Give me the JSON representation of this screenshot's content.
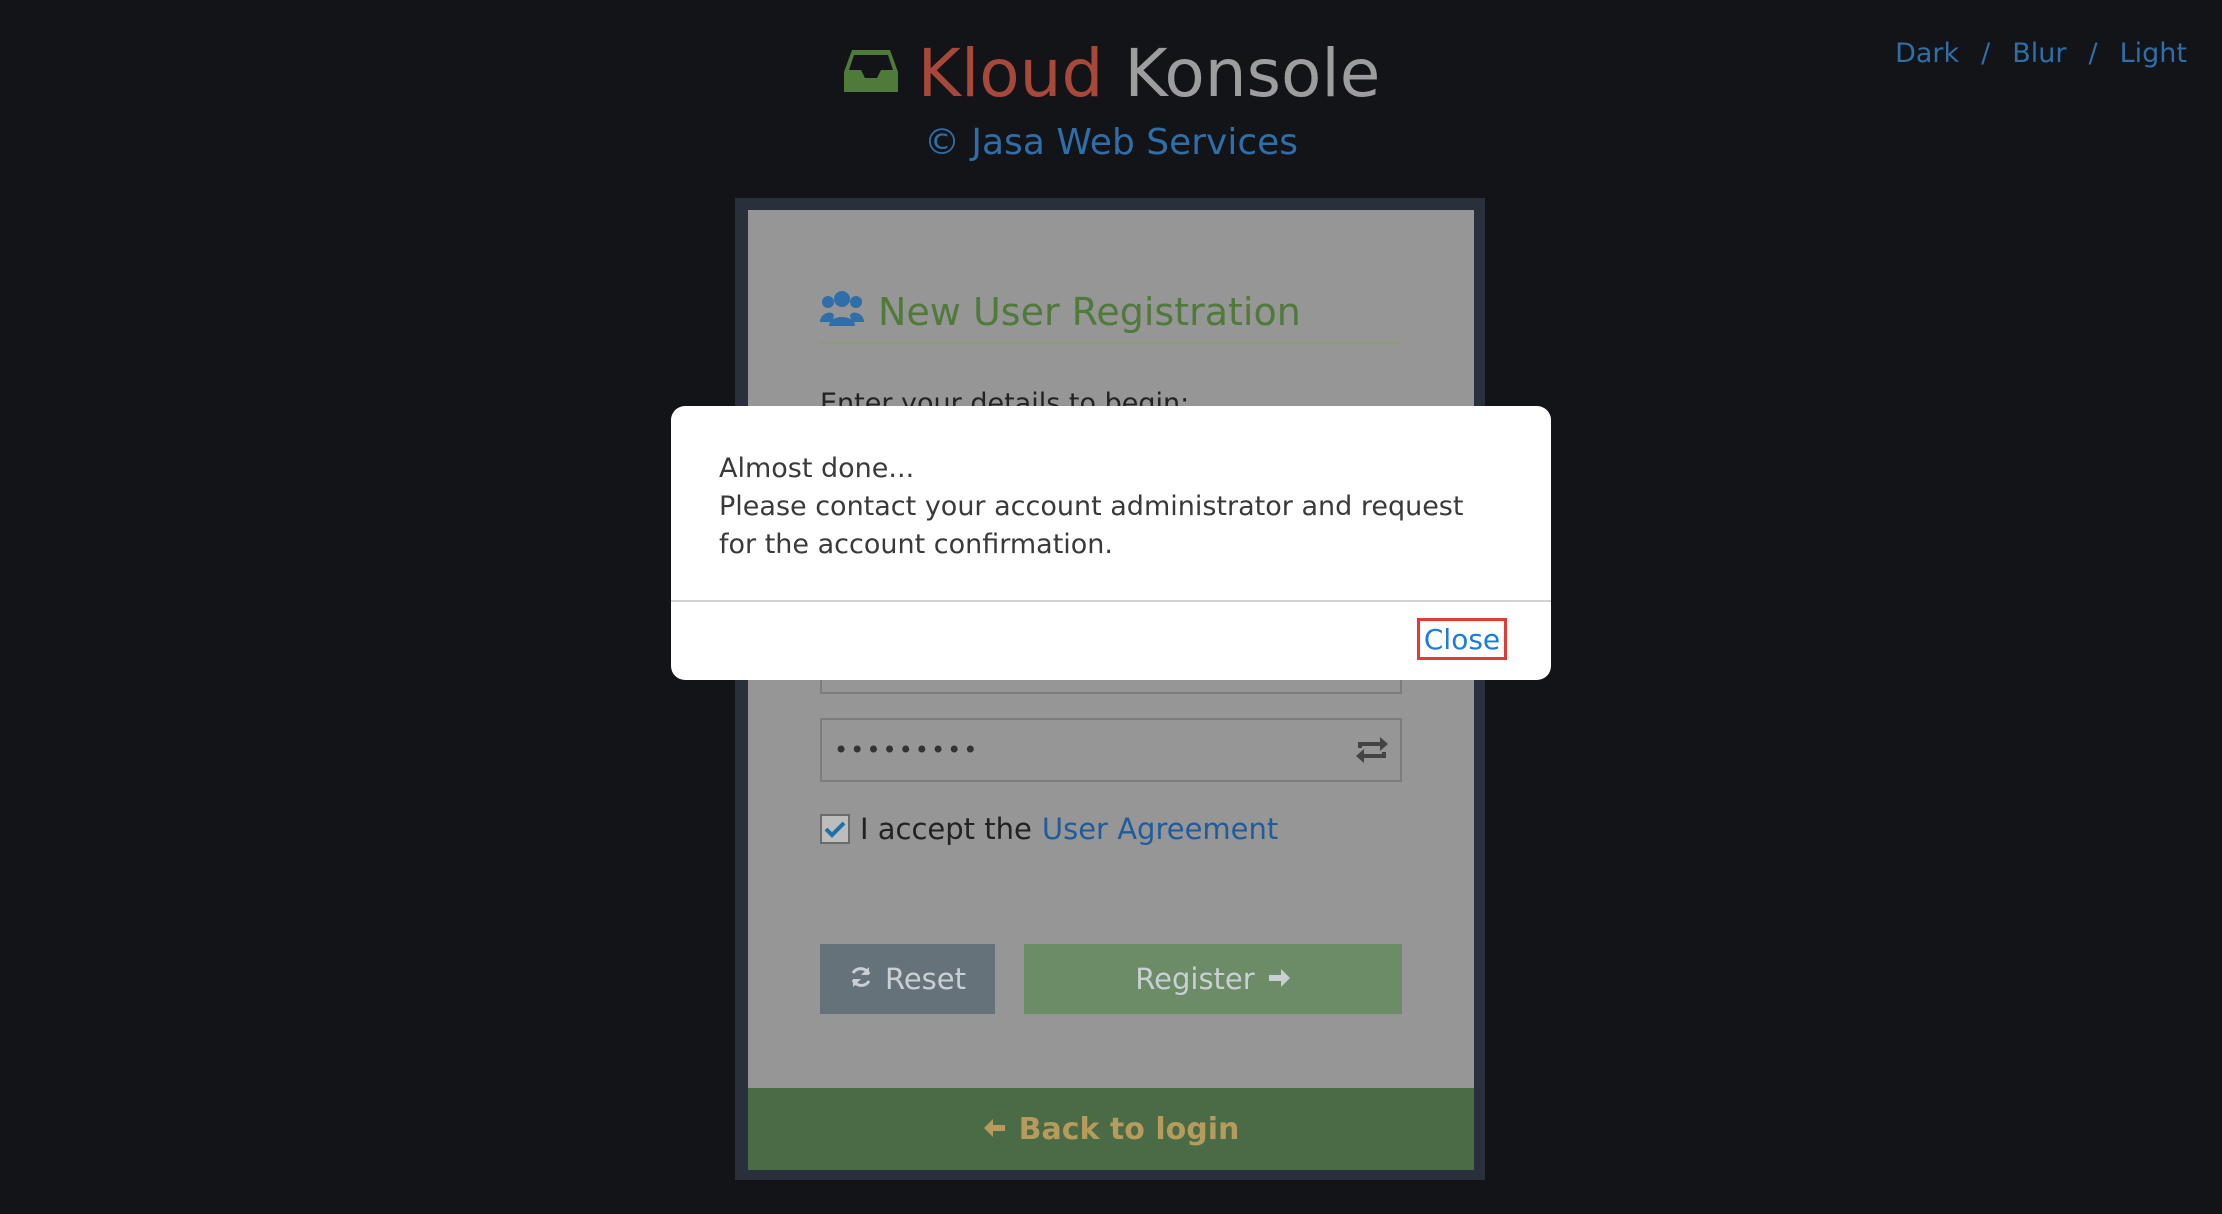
{
  "theme_switcher": {
    "dark": "Dark",
    "separator": "/",
    "blur": "Blur",
    "light": "Light"
  },
  "header": {
    "brand_part1": "Kloud",
    "brand_part2": "Konsole",
    "tagline": "© Jasa Web Services",
    "logo_icon": "inbox-tray-icon"
  },
  "registration": {
    "title": "New User Registration",
    "title_icon": "users-icon",
    "hint": "Enter your details to begin:",
    "password_value": "•••••••••",
    "password_icon": "refresh-arrows-icon",
    "agree_prefix": "I accept the",
    "agree_link": "User Agreement",
    "agree_checked": true,
    "reset_label": "Reset",
    "register_label": "Register",
    "back_label": "Back to login"
  },
  "modal": {
    "line1": "Almost done...",
    "line2": "Please contact your account administrator and request for the account confirmation.",
    "close_label": "Close"
  },
  "colors": {
    "background": "#121418",
    "kloud": "#a8483b",
    "konsole": "#9d9d9d",
    "link_blue": "#2f6ea8",
    "title_green": "#4f7a3a",
    "back_bar": "#4a6b45",
    "close_highlight": "#e53935"
  }
}
